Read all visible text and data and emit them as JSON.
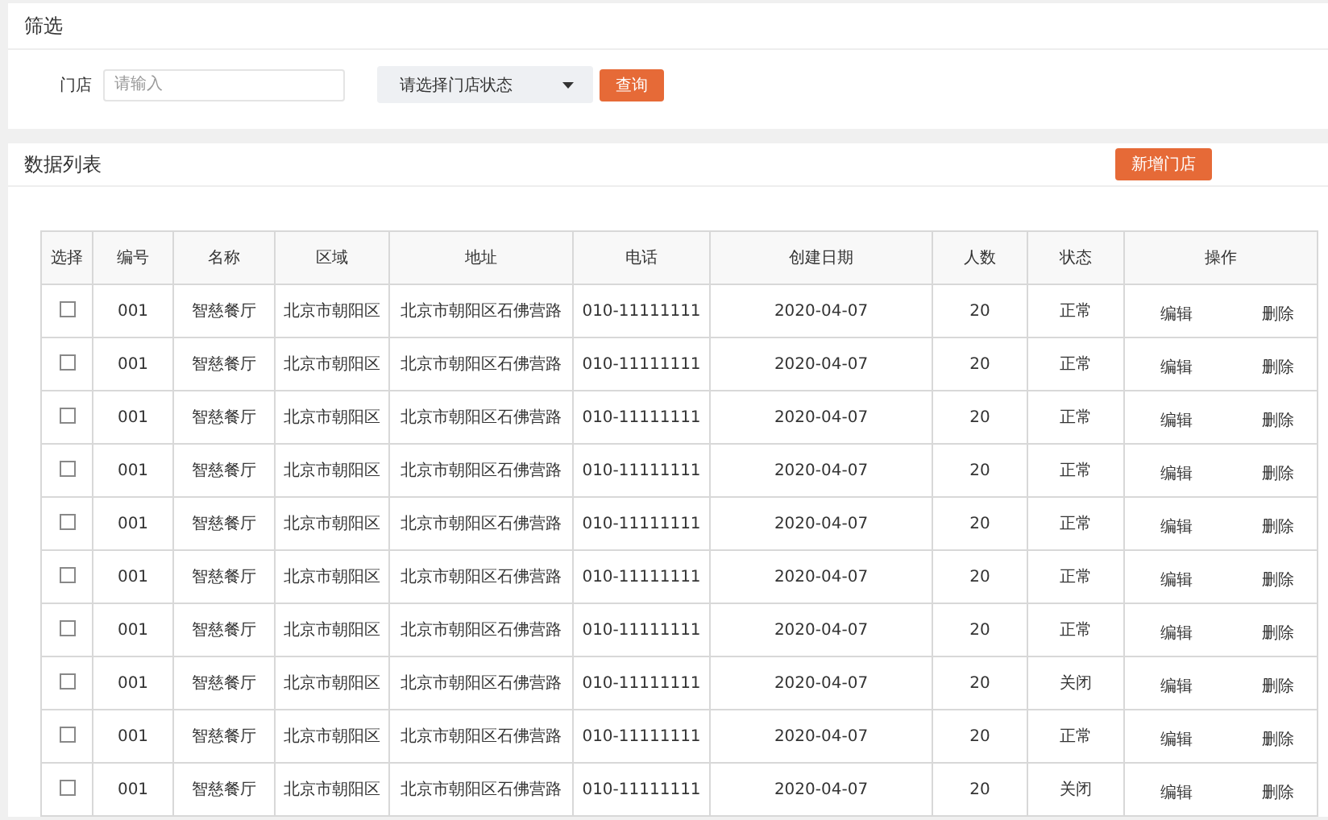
{
  "filter": {
    "title": "筛选",
    "store_label": "门店",
    "store_placeholder": "请输入",
    "status_select": "请选择门店状态",
    "query_button": "查询"
  },
  "list": {
    "title": "数据列表",
    "add_button": "新增门店",
    "columns": [
      "选择",
      "编号",
      "名称",
      "区域",
      "地址",
      "电话",
      "创建日期",
      "人数",
      "状态",
      "操作"
    ],
    "rows": [
      {
        "checked": false,
        "id": "001",
        "name": "智慈餐厅",
        "area": "北京市朝阳区",
        "address": "北京市朝阳区石佛营路",
        "phone": "010-11111111",
        "date": "2020-04-07",
        "count": "20",
        "status": "正常",
        "edit": "编辑",
        "delete": "删除"
      },
      {
        "checked": false,
        "id": "001",
        "name": "智慈餐厅",
        "area": "北京市朝阳区",
        "address": "北京市朝阳区石佛营路",
        "phone": "010-11111111",
        "date": "2020-04-07",
        "count": "20",
        "status": "正常",
        "edit": "编辑",
        "delete": "删除"
      },
      {
        "checked": false,
        "id": "001",
        "name": "智慈餐厅",
        "area": "北京市朝阳区",
        "address": "北京市朝阳区石佛营路",
        "phone": "010-11111111",
        "date": "2020-04-07",
        "count": "20",
        "status": "正常",
        "edit": "编辑",
        "delete": "删除"
      },
      {
        "checked": false,
        "id": "001",
        "name": "智慈餐厅",
        "area": "北京市朝阳区",
        "address": "北京市朝阳区石佛营路",
        "phone": "010-11111111",
        "date": "2020-04-07",
        "count": "20",
        "status": "正常",
        "edit": "编辑",
        "delete": "删除"
      },
      {
        "checked": false,
        "id": "001",
        "name": "智慈餐厅",
        "area": "北京市朝阳区",
        "address": "北京市朝阳区石佛营路",
        "phone": "010-11111111",
        "date": "2020-04-07",
        "count": "20",
        "status": "正常",
        "edit": "编辑",
        "delete": "删除"
      },
      {
        "checked": false,
        "id": "001",
        "name": "智慈餐厅",
        "area": "北京市朝阳区",
        "address": "北京市朝阳区石佛营路",
        "phone": "010-11111111",
        "date": "2020-04-07",
        "count": "20",
        "status": "正常",
        "edit": "编辑",
        "delete": "删除"
      },
      {
        "checked": false,
        "id": "001",
        "name": "智慈餐厅",
        "area": "北京市朝阳区",
        "address": "北京市朝阳区石佛营路",
        "phone": "010-11111111",
        "date": "2020-04-07",
        "count": "20",
        "status": "正常",
        "edit": "编辑",
        "delete": "删除"
      },
      {
        "checked": false,
        "id": "001",
        "name": "智慈餐厅",
        "area": "北京市朝阳区",
        "address": "北京市朝阳区石佛营路",
        "phone": "010-11111111",
        "date": "2020-04-07",
        "count": "20",
        "status": "关闭",
        "edit": "编辑",
        "delete": "删除"
      },
      {
        "checked": false,
        "id": "001",
        "name": "智慈餐厅",
        "area": "北京市朝阳区",
        "address": "北京市朝阳区石佛营路",
        "phone": "010-11111111",
        "date": "2020-04-07",
        "count": "20",
        "status": "正常",
        "edit": "编辑",
        "delete": "删除"
      },
      {
        "checked": false,
        "id": "001",
        "name": "智慈餐厅",
        "area": "北京市朝阳区",
        "address": "北京市朝阳区石佛营路",
        "phone": "010-11111111",
        "date": "2020-04-07",
        "count": "20",
        "status": "关闭",
        "edit": "编辑",
        "delete": "删除"
      }
    ]
  }
}
